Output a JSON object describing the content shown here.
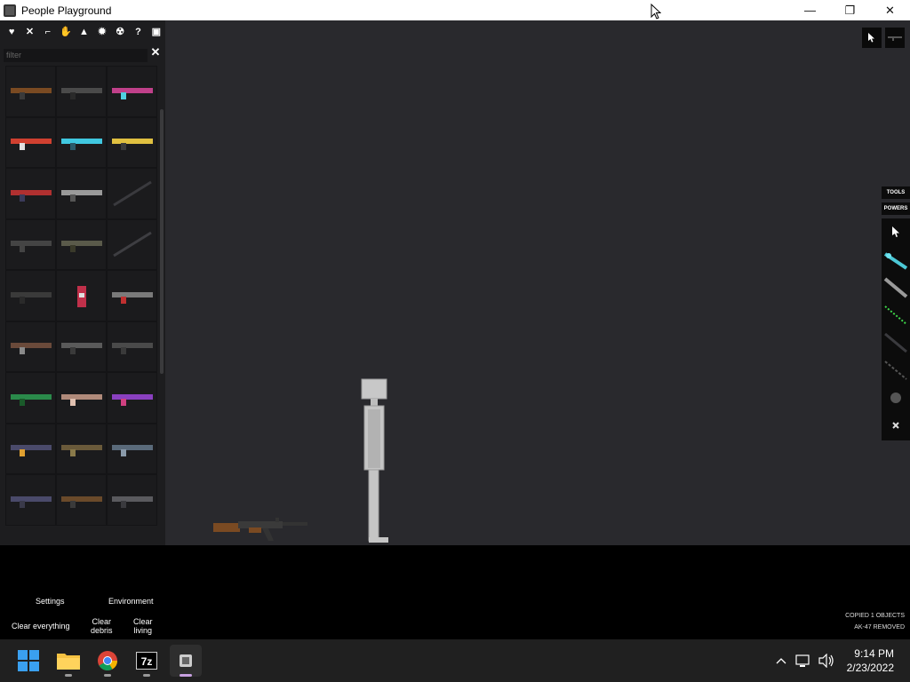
{
  "window": {
    "title": "People Playground",
    "minimize": "—",
    "restore": "❐",
    "close": "✕"
  },
  "sidebar": {
    "categories": [
      {
        "name": "biohazard-icon",
        "glyph": "♥"
      },
      {
        "name": "melee-icon",
        "glyph": "✕"
      },
      {
        "name": "firearms-icon",
        "glyph": "⌐"
      },
      {
        "name": "explosives-icon",
        "glyph": "✋"
      },
      {
        "name": "vehicles-icon",
        "glyph": "▲"
      },
      {
        "name": "machinery-icon",
        "glyph": "✹"
      },
      {
        "name": "biohazard-icon",
        "glyph": "☢"
      },
      {
        "name": "help-icon",
        "glyph": "?"
      },
      {
        "name": "save-icon",
        "glyph": "▣"
      }
    ],
    "filter": {
      "placeholder": "filter",
      "value": "",
      "clear": "✕"
    },
    "items": [
      "ak47",
      "m16",
      "pulse-rifle",
      "phaser-red",
      "phaser-cyan",
      "phaser-yellow",
      "shotgun-red",
      "revolver",
      "rod",
      "rocket-rod",
      "rpg",
      "rod-long",
      "launcher",
      "fire-extinguisher",
      "minigun",
      "flintlock",
      "pistol",
      "heavy-cannon",
      "acid-gun",
      "energy-gun",
      "plasma-launcher",
      "lmg",
      "turret",
      "scoped-rifle",
      "smg",
      "bolt-rifle",
      "crate-gun"
    ]
  },
  "right_toolbar": {
    "tabs": [
      "TOOLS",
      "POWERS"
    ],
    "tools": [
      "pointer-icon",
      "syringe-icon",
      "rod-icon",
      "laser-wire-icon",
      "rope-icon",
      "spring-icon",
      "weight-icon",
      "pin-icon"
    ]
  },
  "bottom_menu": {
    "settings": "Settings",
    "environment": "Environment",
    "clear_everything": "Clear everything",
    "clear_debris_1": "Clear",
    "clear_debris_2": "debris",
    "clear_living_1": "Clear",
    "clear_living_2": "living"
  },
  "status": {
    "line1": "COPIED 1 OBJECTS",
    "line2": "AK-47 REMOVED"
  },
  "taskbar": {
    "time": "9:14 PM",
    "date": "2/23/2022",
    "seven_zip_label": "7z"
  },
  "colors": {
    "world": "#29292d",
    "sidebar": "#1d1d1f",
    "taskbar": "#202020"
  }
}
